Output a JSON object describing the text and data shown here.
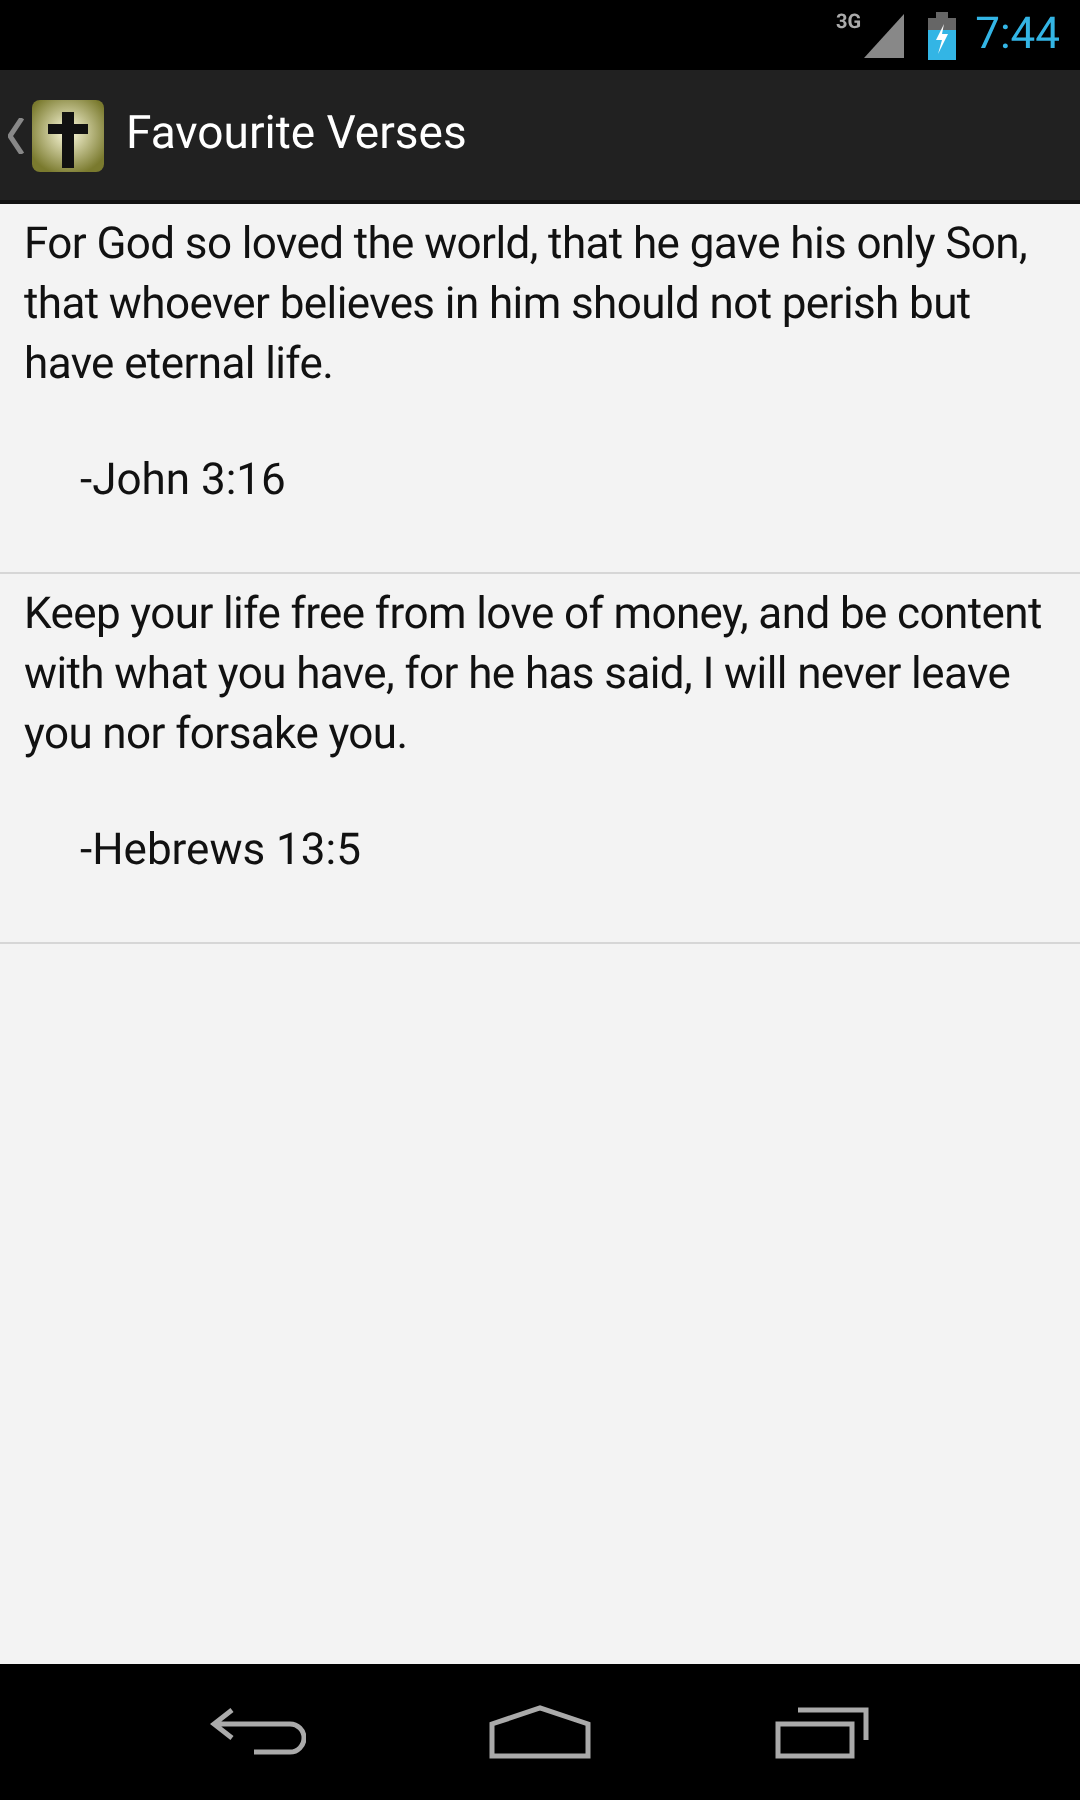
{
  "status_bar": {
    "network": "3G",
    "time": "7:44"
  },
  "action_bar": {
    "title": "Favourite Verses"
  },
  "verses": [
    {
      "text": "For God so loved the world, that he gave his only Son, that whoever believes in him should not perish but have eternal life.",
      "reference": "-John 3:16"
    },
    {
      "text": "Keep your life free from love of money, and be content with what you have, for he has said, I will never leave you nor forsake you.",
      "reference": "-Hebrews 13:5"
    }
  ]
}
